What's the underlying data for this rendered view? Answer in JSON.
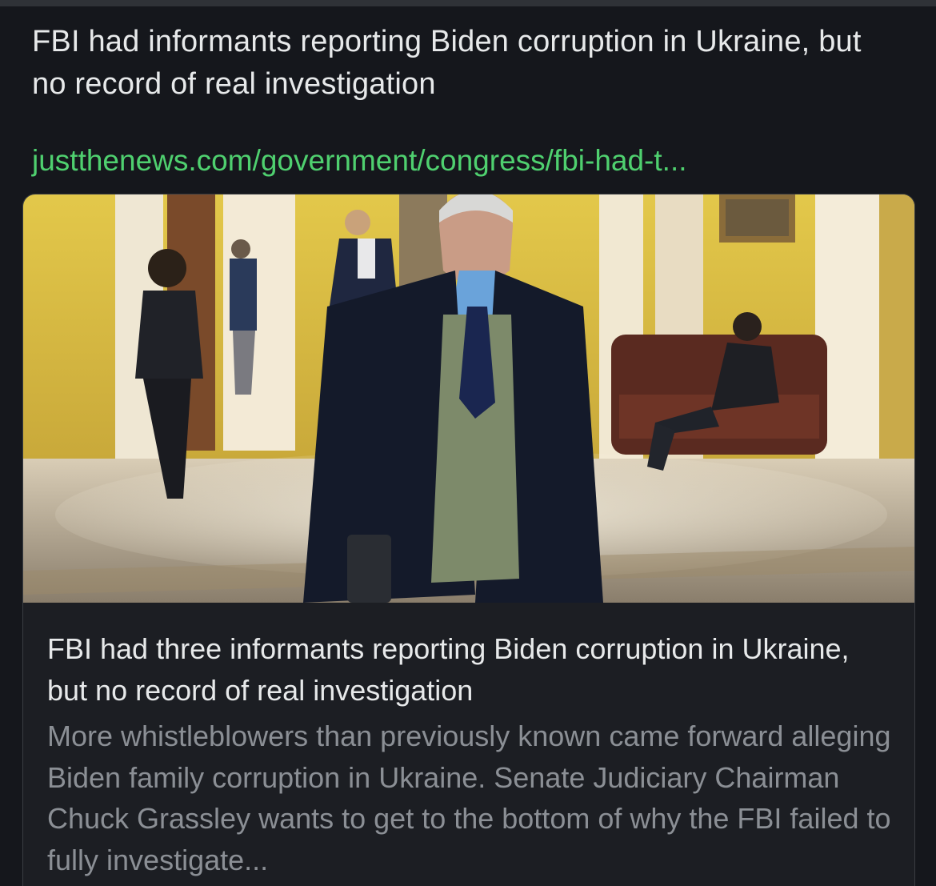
{
  "post": {
    "text": "FBI had informants reporting Biden corruption in Ukraine, but no record of real investigation",
    "link": "justthenews.com/government/congress/fbi-had-t..."
  },
  "card": {
    "image_icon": "photo-senator-in-capitol-hallway",
    "title": "FBI had three informants reporting Biden corruption in Ukraine, but no record of real investigation",
    "description": "More whistleblowers than previously known came forward alleging Biden family corruption in Ukraine. Senate Judiciary Chairman Chuck Grassley wants to get to the bottom of why the FBI failed to fully investigate..."
  },
  "colors": {
    "background": "#15171c",
    "link": "#4fd06f",
    "text": "#e7e9ea",
    "muted": "#8b8f95"
  }
}
